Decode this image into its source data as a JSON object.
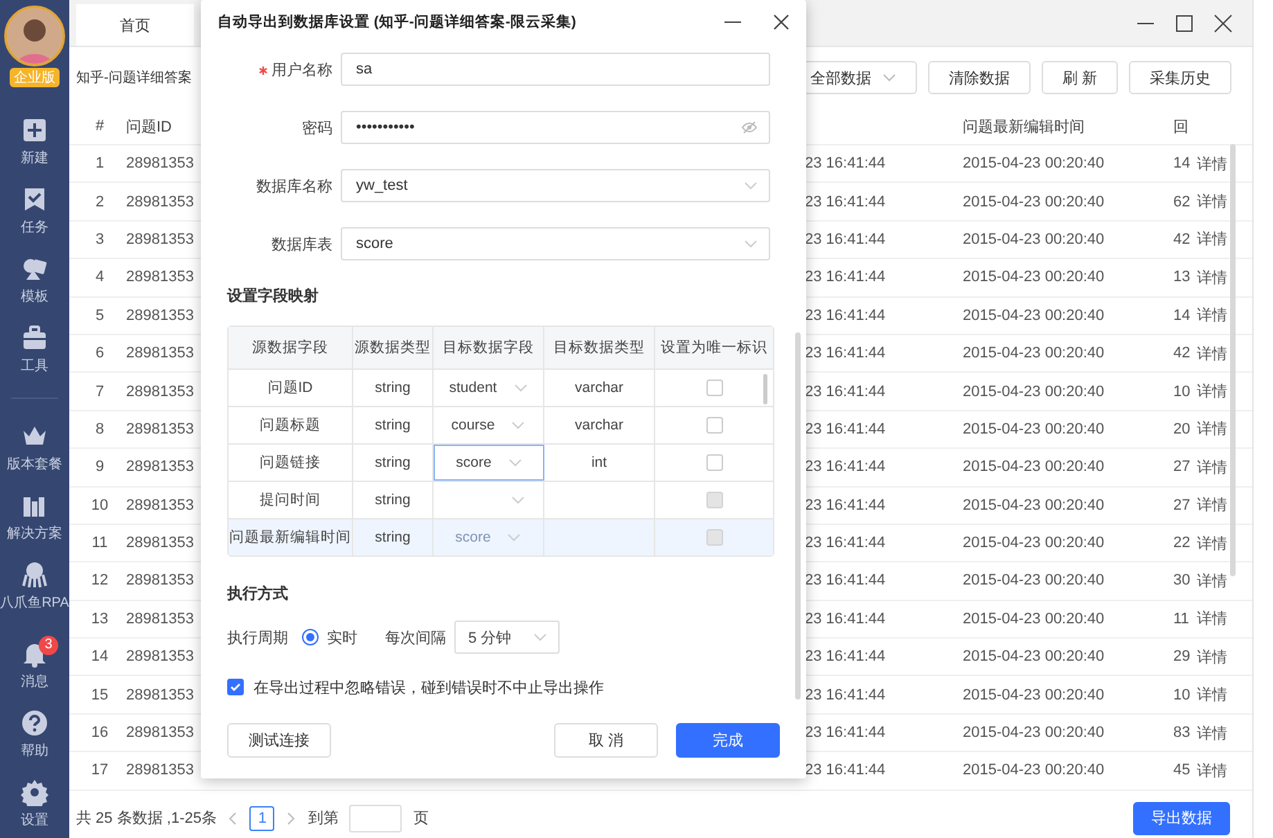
{
  "sidebar": {
    "edition_badge": "企业版",
    "items": [
      {
        "label": "新建"
      },
      {
        "label": "任务"
      },
      {
        "label": "模板"
      },
      {
        "label": "工具"
      }
    ],
    "plan_items": [
      {
        "label": "版本套餐"
      },
      {
        "label": "解决方案"
      },
      {
        "label": "八爪鱼RPA"
      }
    ],
    "system_items": [
      {
        "label": "消息",
        "badge": "3"
      },
      {
        "label": "帮助"
      },
      {
        "label": "设置"
      }
    ]
  },
  "tabs": [
    {
      "label": "首页",
      "selected": true
    }
  ],
  "task_title": "知乎-问题详细答案",
  "toolbar": {
    "filter": "全部数据",
    "buttons": [
      "清除数据",
      "刷 新",
      "采集历史"
    ]
  },
  "table": {
    "columns": [
      "#",
      "问题ID",
      "问题最新编辑时间",
      "回"
    ],
    "rows": [
      {
        "no": "1",
        "question_id": "28981353",
        "column_3": "23 16:41:44",
        "edit_time": "2015-04-23 00:20:40",
        "column_5": "14",
        "action": "详情"
      },
      {
        "no": "2",
        "question_id": "28981353",
        "column_3": "23 16:41:44",
        "edit_time": "2015-04-23 00:20:40",
        "column_5": "62",
        "action": "详情"
      },
      {
        "no": "3",
        "question_id": "28981353",
        "column_3": "23 16:41:44",
        "edit_time": "2015-04-23 00:20:40",
        "column_5": "42",
        "action": "详情"
      },
      {
        "no": "4",
        "question_id": "28981353",
        "column_3": "23 16:41:44",
        "edit_time": "2015-04-23 00:20:40",
        "column_5": "13",
        "action": "详情"
      },
      {
        "no": "5",
        "question_id": "28981353",
        "column_3": "23 16:41:44",
        "edit_time": "2015-04-23 00:20:40",
        "column_5": "14",
        "action": "详情"
      },
      {
        "no": "6",
        "question_id": "28981353",
        "column_3": "23 16:41:44",
        "edit_time": "2015-04-23 00:20:40",
        "column_5": "42",
        "action": "详情"
      },
      {
        "no": "7",
        "question_id": "28981353",
        "column_3": "23 16:41:44",
        "edit_time": "2015-04-23 00:20:40",
        "column_5": "10",
        "action": "详情"
      },
      {
        "no": "8",
        "question_id": "28981353",
        "column_3": "23 16:41:44",
        "edit_time": "2015-04-23 00:20:40",
        "column_5": "20",
        "action": "详情"
      },
      {
        "no": "9",
        "question_id": "28981353",
        "column_3": "23 16:41:44",
        "edit_time": "2015-04-23 00:20:40",
        "column_5": "27",
        "action": "详情"
      },
      {
        "no": "10",
        "question_id": "28981353",
        "column_3": "23 16:41:44",
        "edit_time": "2015-04-23 00:20:40",
        "column_5": "27",
        "action": "详情"
      },
      {
        "no": "11",
        "question_id": "28981353",
        "column_3": "23 16:41:44",
        "edit_time": "2015-04-23 00:20:40",
        "column_5": "22",
        "action": "详情"
      },
      {
        "no": "12",
        "question_id": "28981353",
        "column_3": "23 16:41:44",
        "edit_time": "2015-04-23 00:20:40",
        "column_5": "30",
        "action": "详情"
      },
      {
        "no": "13",
        "question_id": "28981353",
        "column_3": "23 16:41:44",
        "edit_time": "2015-04-23 00:20:40",
        "column_5": "11",
        "action": "详情"
      },
      {
        "no": "14",
        "question_id": "28981353",
        "column_3": "23 16:41:44",
        "edit_time": "2015-04-23 00:20:40",
        "column_5": "29",
        "action": "详情"
      },
      {
        "no": "15",
        "question_id": "28981353",
        "column_3": "23 16:41:44",
        "edit_time": "2015-04-23 00:20:40",
        "column_5": "10",
        "action": "详情"
      },
      {
        "no": "16",
        "question_id": "28981353",
        "column_3": "23 16:41:44",
        "edit_time": "2015-04-23 00:20:40",
        "column_5": "83",
        "action": "详情"
      },
      {
        "no": "17",
        "question_id": "28981353",
        "column_3": "23 16:41:44",
        "edit_time": "2015-04-23 00:20:40",
        "column_5": "45",
        "action": "详情"
      }
    ]
  },
  "pager": {
    "summary": "共 25 条数据 ,1-25条",
    "pages": [
      {
        "label": "1",
        "selected": true
      }
    ],
    "goto_label": "到第",
    "page_suffix": "页",
    "export_button": "导出数据"
  },
  "dialog": {
    "title": "自动导出到数据库设置 (知乎-问题详细答案-限云采集)",
    "fields": [
      {
        "kind": "text",
        "label": "用户名称",
        "required": true,
        "value": "sa"
      },
      {
        "kind": "password",
        "label": "密码",
        "required": false,
        "value": "•••••••••••"
      },
      {
        "kind": "select",
        "label": "数据库名称",
        "required": false,
        "value": "yw_test"
      },
      {
        "kind": "select",
        "label": "数据库表",
        "required": false,
        "value": "score"
      }
    ],
    "mapping": {
      "heading": "设置字段映射",
      "columns": [
        "源数据字段",
        "源数据类型",
        "目标数据字段",
        "目标数据类型",
        "设置为唯一标识"
      ],
      "rows": [
        {
          "source": "问题ID",
          "source_type": "string",
          "target": "student",
          "target_type": "varchar",
          "focused": false,
          "hovered": false,
          "ghost": false,
          "unique_checked": false,
          "unique_disabled": false
        },
        {
          "source": "问题标题",
          "source_type": "string",
          "target": "course",
          "target_type": "varchar",
          "focused": false,
          "hovered": false,
          "ghost": false,
          "unique_checked": false,
          "unique_disabled": false
        },
        {
          "source": "问题链接",
          "source_type": "string",
          "target": "score",
          "target_type": "int",
          "focused": true,
          "hovered": false,
          "ghost": false,
          "unique_checked": false,
          "unique_disabled": false
        },
        {
          "source": "提问时间",
          "source_type": "string",
          "focused": false,
          "hovered": false,
          "ghost": false,
          "unique_checked": false,
          "unique_disabled": true
        },
        {
          "source": "问题最新编辑时间",
          "source_type": "string",
          "target": "score",
          "focused": false,
          "hovered": true,
          "ghost": true,
          "unique_checked": false,
          "unique_disabled": true
        }
      ]
    },
    "execution": {
      "heading": "执行方式",
      "period_label": "执行周期",
      "modes": [
        {
          "label": "实时",
          "selected": true
        }
      ],
      "interval_label": "每次间隔",
      "interval": "5 分钟"
    },
    "ignore_errors": {
      "label": "在导出过程中忽略错误，碰到错误时不中止导出操作",
      "checked": true
    },
    "buttons": [
      {
        "label": "测试连接",
        "kind": "secondary"
      },
      {
        "label": "取 消",
        "kind": "secondary"
      },
      {
        "label": "完成",
        "kind": "primary"
      }
    ]
  }
}
